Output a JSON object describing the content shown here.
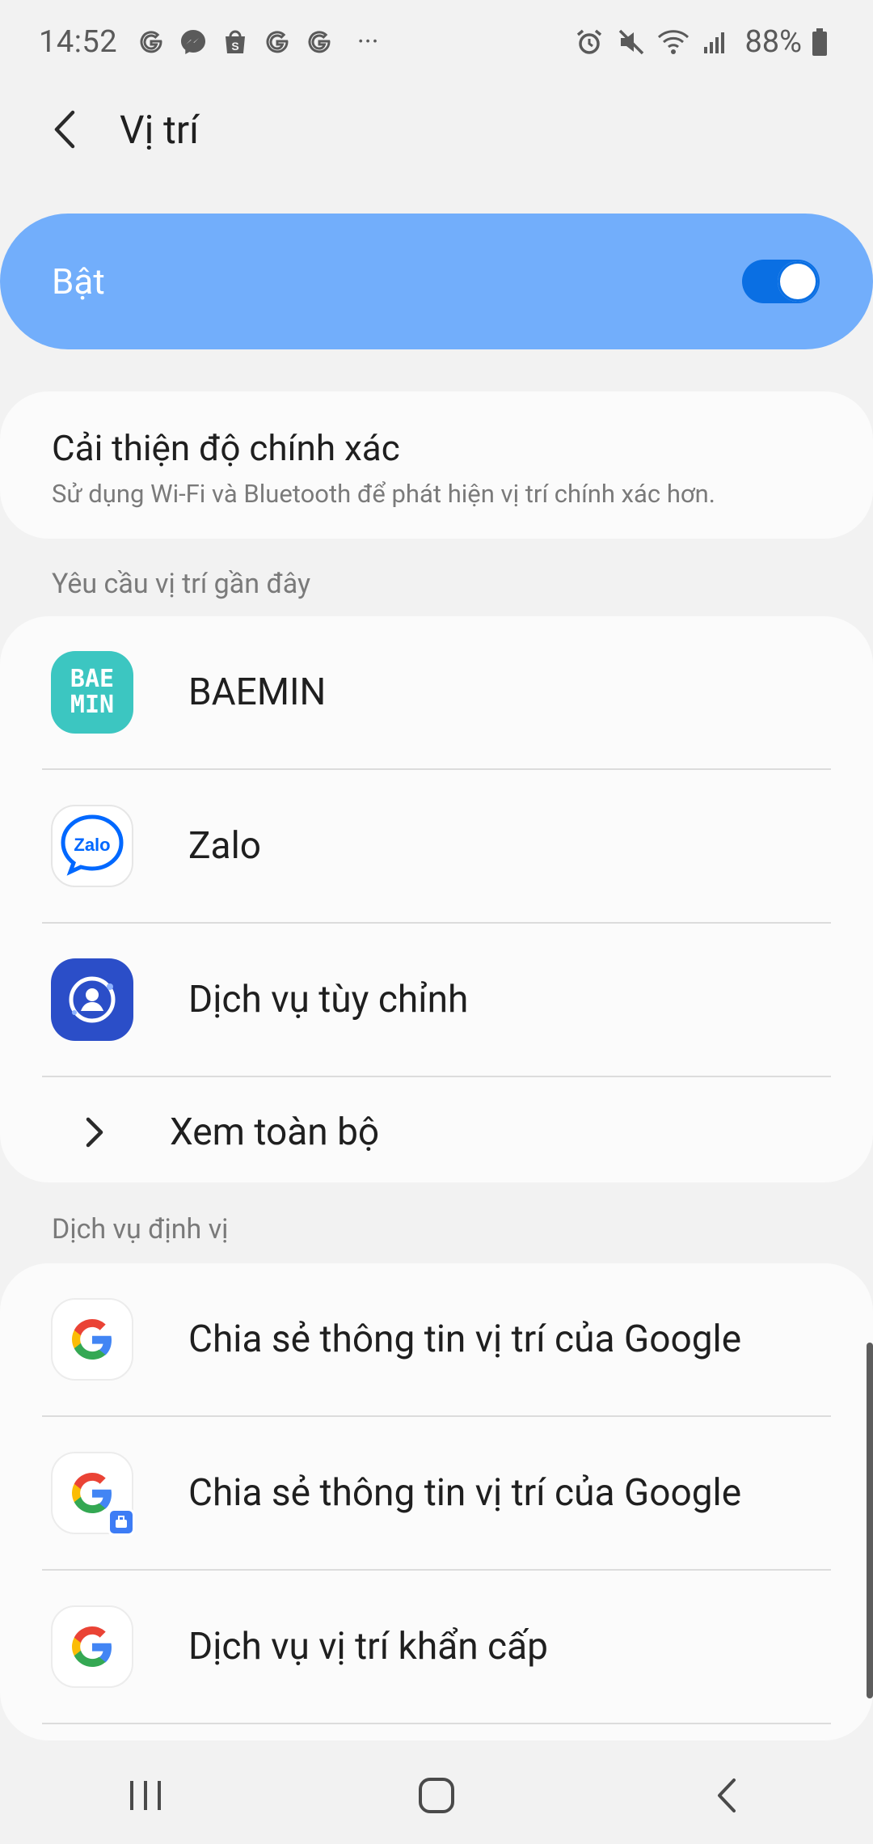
{
  "status_bar": {
    "time": "14:52",
    "battery": "88%",
    "more_indicator": "···",
    "left_icons": [
      "google-g-icon",
      "messenger-icon",
      "shopping-bag-s-icon",
      "google-g-icon",
      "google-g-icon"
    ],
    "right_icons": [
      "alarm-icon",
      "mute-icon",
      "wifi-icon",
      "signal-icon",
      "battery-icon"
    ]
  },
  "header": {
    "title": "Vị trí",
    "back_icon": "chevron-left-icon"
  },
  "master": {
    "label": "Bật",
    "enabled": true,
    "color": "#72aefb",
    "switch_color": "#0a6fe3"
  },
  "accuracy": {
    "title": "Cải thiện độ chính xác",
    "subtitle": "Sử dụng Wi-Fi và Bluetooth để phát hiện vị trí chính xác hơn."
  },
  "recent": {
    "header": "Yêu cầu vị trí gần đây",
    "items": [
      {
        "label": "BAEMIN",
        "icon": "baemin-icon",
        "icon_text_top": "BAE",
        "icon_text_bottom": "MIN"
      },
      {
        "label": "Zalo",
        "icon": "zalo-icon",
        "icon_text": "Zalo"
      },
      {
        "label": "Dịch vụ tùy chỉnh",
        "icon": "customization-service-icon"
      }
    ],
    "see_all": "Xem toàn bộ"
  },
  "services": {
    "header": "Dịch vụ định vị",
    "items": [
      {
        "label": "Chia sẻ thông tin vị trí của Google",
        "icon": "google-icon"
      },
      {
        "label": "Chia sẻ thông tin vị trí của Google",
        "icon": "google-work-icon"
      },
      {
        "label": "Dịch vụ vị trí khẩn cấp",
        "icon": "google-icon"
      }
    ]
  },
  "nav": {
    "recents_icon": "recents-icon",
    "home_icon": "home-icon",
    "back_icon": "back-icon"
  }
}
